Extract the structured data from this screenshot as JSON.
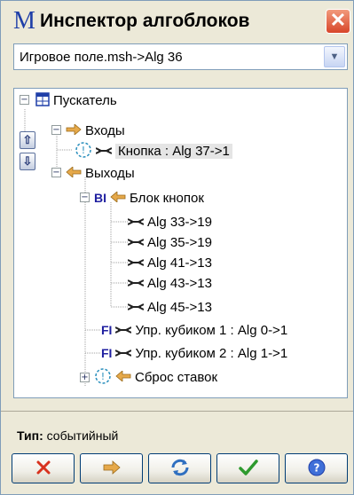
{
  "window": {
    "app_logo": "M",
    "title": "Инспектор алгоблоков",
    "close_glyph": "✕"
  },
  "selector": {
    "value": "Игровое поле.msh->Alg 36"
  },
  "tree": {
    "root": "Пускатель",
    "inputs": "Входы",
    "inputs_child": "Кнопка : Alg 37->1",
    "outputs": "Выходы",
    "button_block_tag": "BI",
    "button_block": "Блок кнопок",
    "links": [
      "Alg 33->19",
      "Alg 35->19",
      "Alg 41->13",
      "Alg 43->13",
      "Alg 45->13"
    ],
    "fi_tag": "FI",
    "cube_controls": [
      "Упр. кубиком 1 : Alg 0->1",
      "Упр. кубиком 2 : Alg 1->1"
    ],
    "reset_bets": "Сброс ставок"
  },
  "footer": {
    "type_label": "Тип:",
    "type_value": "событийный"
  },
  "icons": {
    "move_up": "⇧",
    "move_down": "⇩"
  },
  "colors": {
    "accent": "#1f3fa8",
    "close_red": "#d8462a",
    "ok_green": "#2e9a2e"
  }
}
